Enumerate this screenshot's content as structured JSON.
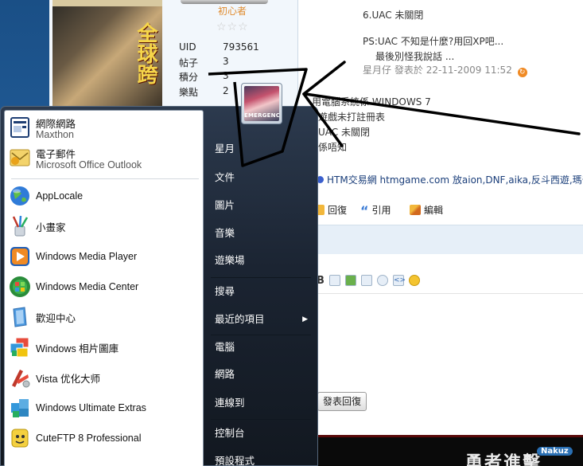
{
  "profile": {
    "rank_title": "初心者",
    "stars": "☆☆☆",
    "stats": [
      {
        "label": "UID",
        "value": "793561"
      },
      {
        "label": "帖子",
        "value": "3"
      },
      {
        "label": "積分",
        "value": "3"
      },
      {
        "label": "樂點",
        "value": "2"
      }
    ],
    "banner_text": "全球跨"
  },
  "post": {
    "top_line": "6.UAC 未關閉",
    "quote_line1": "PS:UAC 不知是什麼?用回XP吧...",
    "quote_line2": "最後別怪我說話 ...",
    "meta_author": "星月仔",
    "meta_posted": "發表於",
    "meta_time": "22-11-2009 11:52",
    "body_lines": [
      "用電腦系統係 WINDOWS 7",
      "遊戲未打註冊表",
      "UAC 未關閉",
      "係唔知"
    ],
    "ad_text": "HTM交易網",
    "ad_link": "htmgame.com",
    "ad_tail": "放aion,DNF,aika,反斗西遊,瑪奇,巨",
    "actions": {
      "reply": "回復",
      "quote": "引用",
      "edit": "編輯"
    },
    "reply_button": "發表回復",
    "banner_text": "勇者進擊",
    "banner_logo": "Nakuz"
  },
  "start_menu": {
    "pinned": [
      {
        "label": "網際網路",
        "sub": "Maxthon",
        "icon": "maxthon-icon"
      },
      {
        "label": "電子郵件",
        "sub": "Microsoft Office Outlook",
        "icon": "outlook-icon"
      }
    ],
    "programs": [
      {
        "label": "AppLocale",
        "icon": "applocale-globe-icon"
      },
      {
        "label": "小畫家",
        "icon": "paint-brushes-icon"
      },
      {
        "label": "Windows Media Player",
        "icon": "media-player-icon"
      },
      {
        "label": "Windows Media Center",
        "icon": "media-center-icon"
      },
      {
        "label": "歡迎中心",
        "icon": "welcome-center-icon"
      },
      {
        "label": "Windows 相片圖庫",
        "icon": "photo-gallery-icon"
      },
      {
        "label": "Vista 优化大师",
        "icon": "vista-optimizer-icon"
      },
      {
        "label": "Windows Ultimate Extras",
        "icon": "ultimate-extras-icon"
      },
      {
        "label": "CuteFTP 8 Professional",
        "icon": "cuteftp-icon"
      }
    ],
    "user_pic_tag": "EMERGENCY",
    "right_items": [
      {
        "label": "星月"
      },
      {
        "label": "文件"
      },
      {
        "label": "圖片"
      },
      {
        "label": "音樂"
      },
      {
        "label": "遊樂場"
      },
      {
        "label": "搜尋"
      },
      {
        "label": "最近的項目",
        "arrow": "▶"
      },
      {
        "label": "電腦"
      },
      {
        "label": "網路"
      },
      {
        "label": "連線到"
      },
      {
        "label": "控制台"
      },
      {
        "label": "預設程式"
      }
    ]
  },
  "colors": {
    "start_menu_bg": "#1b2432",
    "rank_orange": "#e08b2d",
    "link_blue": "#1a3e7a"
  }
}
